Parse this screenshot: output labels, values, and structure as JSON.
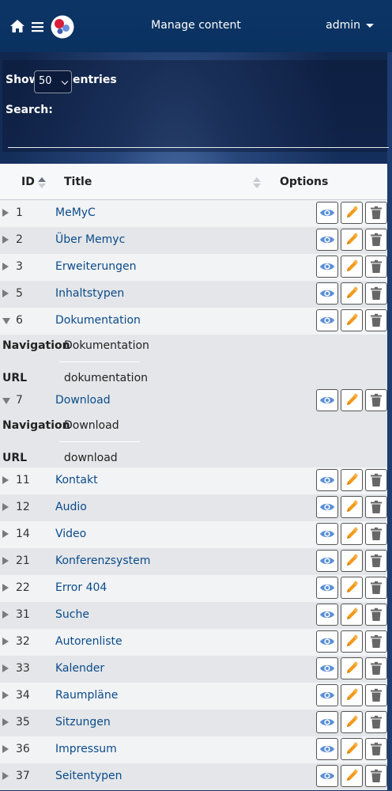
{
  "header": {
    "title": "Manage content",
    "user": "admin"
  },
  "controls": {
    "show_label": "Show",
    "page_size": "50",
    "entries_label": "entries",
    "search_label": "Search:",
    "search_value": ""
  },
  "table": {
    "columns": {
      "id": "ID",
      "title": "Title",
      "options": "Options"
    },
    "rows": [
      {
        "id": "1",
        "title": "MeMyC",
        "expanded": false
      },
      {
        "id": "2",
        "title": "Über Memyc",
        "expanded": false
      },
      {
        "id": "3",
        "title": "Erweiterungen",
        "expanded": false
      },
      {
        "id": "5",
        "title": "Inhaltstypen",
        "expanded": false
      },
      {
        "id": "6",
        "title": "Dokumentation",
        "expanded": true,
        "details": {
          "nav_key": "Navigation",
          "nav_val": "Dokumentation",
          "url_key": "URL",
          "url_val": "dokumentation"
        }
      },
      {
        "id": "7",
        "title": "Download",
        "expanded": true,
        "details": {
          "nav_key": "Navigation",
          "nav_val": "Download",
          "url_key": "URL",
          "url_val": "download"
        }
      },
      {
        "id": "11",
        "title": "Kontakt",
        "expanded": false
      },
      {
        "id": "12",
        "title": "Audio",
        "expanded": false
      },
      {
        "id": "14",
        "title": "Video",
        "expanded": false
      },
      {
        "id": "21",
        "title": "Konferenzsystem",
        "expanded": false
      },
      {
        "id": "22",
        "title": "Error 404",
        "expanded": false
      },
      {
        "id": "31",
        "title": "Suche",
        "expanded": false
      },
      {
        "id": "32",
        "title": "Autorenliste",
        "expanded": false
      },
      {
        "id": "33",
        "title": "Kalender",
        "expanded": false
      },
      {
        "id": "34",
        "title": "Raumpläne",
        "expanded": false
      },
      {
        "id": "35",
        "title": "Sitzungen",
        "expanded": false
      },
      {
        "id": "36",
        "title": "Impressum",
        "expanded": false
      },
      {
        "id": "37",
        "title": "Seitentypen",
        "expanded": false
      }
    ]
  },
  "colors": {
    "navbar": "#0c3566",
    "link": "#0a4b8a",
    "view_icon": "#5b8fd6",
    "edit_icon": "#f39a1a",
    "delete_icon": "#666666"
  },
  "icons": {
    "home": "home-icon",
    "menu": "hamburger-icon",
    "logo": "app-logo",
    "view": "eye-icon",
    "edit": "pencil-icon",
    "delete": "trash-icon",
    "sort": "sort-icon",
    "expand": "triangle-right-icon",
    "collapse": "triangle-down-icon"
  }
}
